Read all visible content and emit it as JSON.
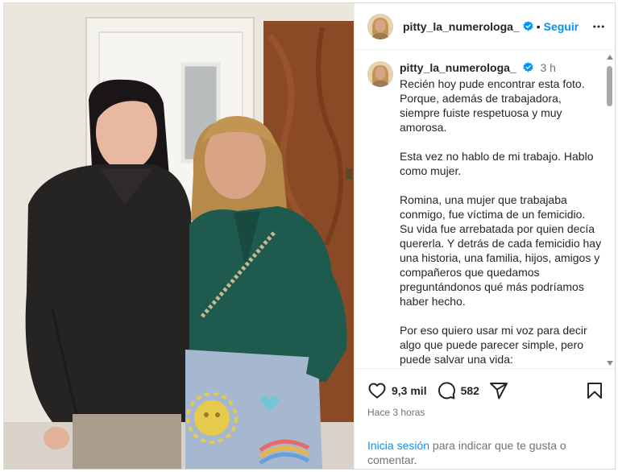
{
  "header": {
    "username": "pitty_la_numerologa_",
    "separator": "•",
    "follow_label": "Seguir"
  },
  "caption": {
    "username": "pitty_la_numerologa_",
    "time": "3 h",
    "text": "Recién hoy pude encontrar esta foto.\nPorque, además de trabajadora,\nsiempre fuiste respetuosa y muy\namorosa.\n\nEsta vez no hablo de mi trabajo. Hablo\ncomo mujer.\n\nRomina, una mujer que trabajaba\nconmigo, fue víctima de un femicidio.\nSu vida fue arrebatada por quien decía\nquererla. Y detrás de cada femicidio hay\nuna historia, una familia, hijos, amigos y\ncompañeros que quedamos\npreguntándonos qué más podríamos\nhaber hecho.\n\nPor eso quiero usar mi voz para decir\nalgo que puede parecer simple, pero\npuede salvar una vida:"
  },
  "actions": {
    "likes": "9,3 mil",
    "comments": "582",
    "posted_ago": "Hace 3 horas"
  },
  "login_prompt": {
    "link": "Inicia sesión",
    "text": " para indicar que te gusta o comentar."
  },
  "colors": {
    "accent": "#0095f6",
    "verified": "#0095f6",
    "muted": "#737373"
  },
  "icons": [
    "verified-badge-icon",
    "more-options-icon",
    "heart-icon",
    "comment-icon",
    "share-icon",
    "bookmark-icon",
    "scroll-up-icon",
    "scroll-down-icon"
  ]
}
